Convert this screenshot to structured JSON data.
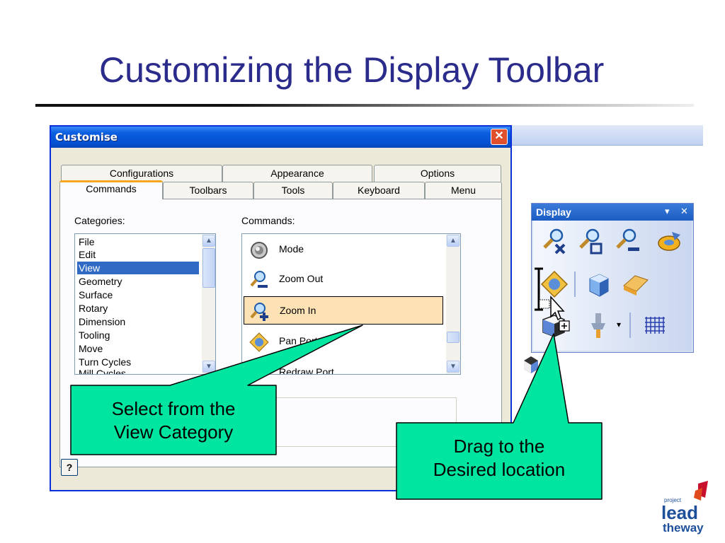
{
  "slide": {
    "title": "Customizing the Display Toolbar"
  },
  "dialog": {
    "title": "Customise",
    "close_icon": "✕",
    "tabs_back": [
      "Configurations",
      "Appearance",
      "Options"
    ],
    "tabs_front": [
      "Commands",
      "Toolbars",
      "Tools",
      "Keyboard",
      "Menu"
    ],
    "categories_label": "Categories:",
    "commands_label": "Commands:",
    "categories": [
      "File",
      "Edit",
      "View",
      "Geometry",
      "Surface",
      "Rotary",
      "Dimension",
      "Tooling",
      "Move",
      "Turn Cycles",
      "Mill Cycles"
    ],
    "selected_category": "View",
    "commands": [
      {
        "label": "Mode",
        "icon": "mode-icon"
      },
      {
        "label": "Zoom Out",
        "icon": "zoom-out-icon"
      },
      {
        "label": "Zoom In",
        "icon": "zoom-in-icon"
      },
      {
        "label": "Pan Port",
        "icon": "pan-icon"
      },
      {
        "label": "Redraw Port",
        "icon": "redraw-icon"
      }
    ],
    "selected_command": "Zoom In",
    "help_icon": "?"
  },
  "display_toolbar": {
    "title": "Display",
    "dropdown_icon": "▾",
    "close_icon": "✕",
    "icons": [
      "zoom-fit-icon",
      "zoom-window-icon",
      "zoom-out-icon",
      "refresh-icon",
      "pan-icon",
      "shaded-view-icon",
      "plane-view-icon",
      "iso-view-icon",
      "tool-holder-icon",
      "grid-icon"
    ]
  },
  "callouts": {
    "left": [
      "Select from the",
      "View Category"
    ],
    "right": [
      "Drag to the",
      "Desired location"
    ]
  },
  "logo": {
    "small": "project",
    "main1": "lead",
    "main2": "theway"
  },
  "colors": {
    "title": "#2b2b8c",
    "callout_fill": "#00e6a0",
    "selection_blue": "#316ac5",
    "selected_command_fill": "#fce2b4",
    "logo_red": "#c8102e"
  }
}
